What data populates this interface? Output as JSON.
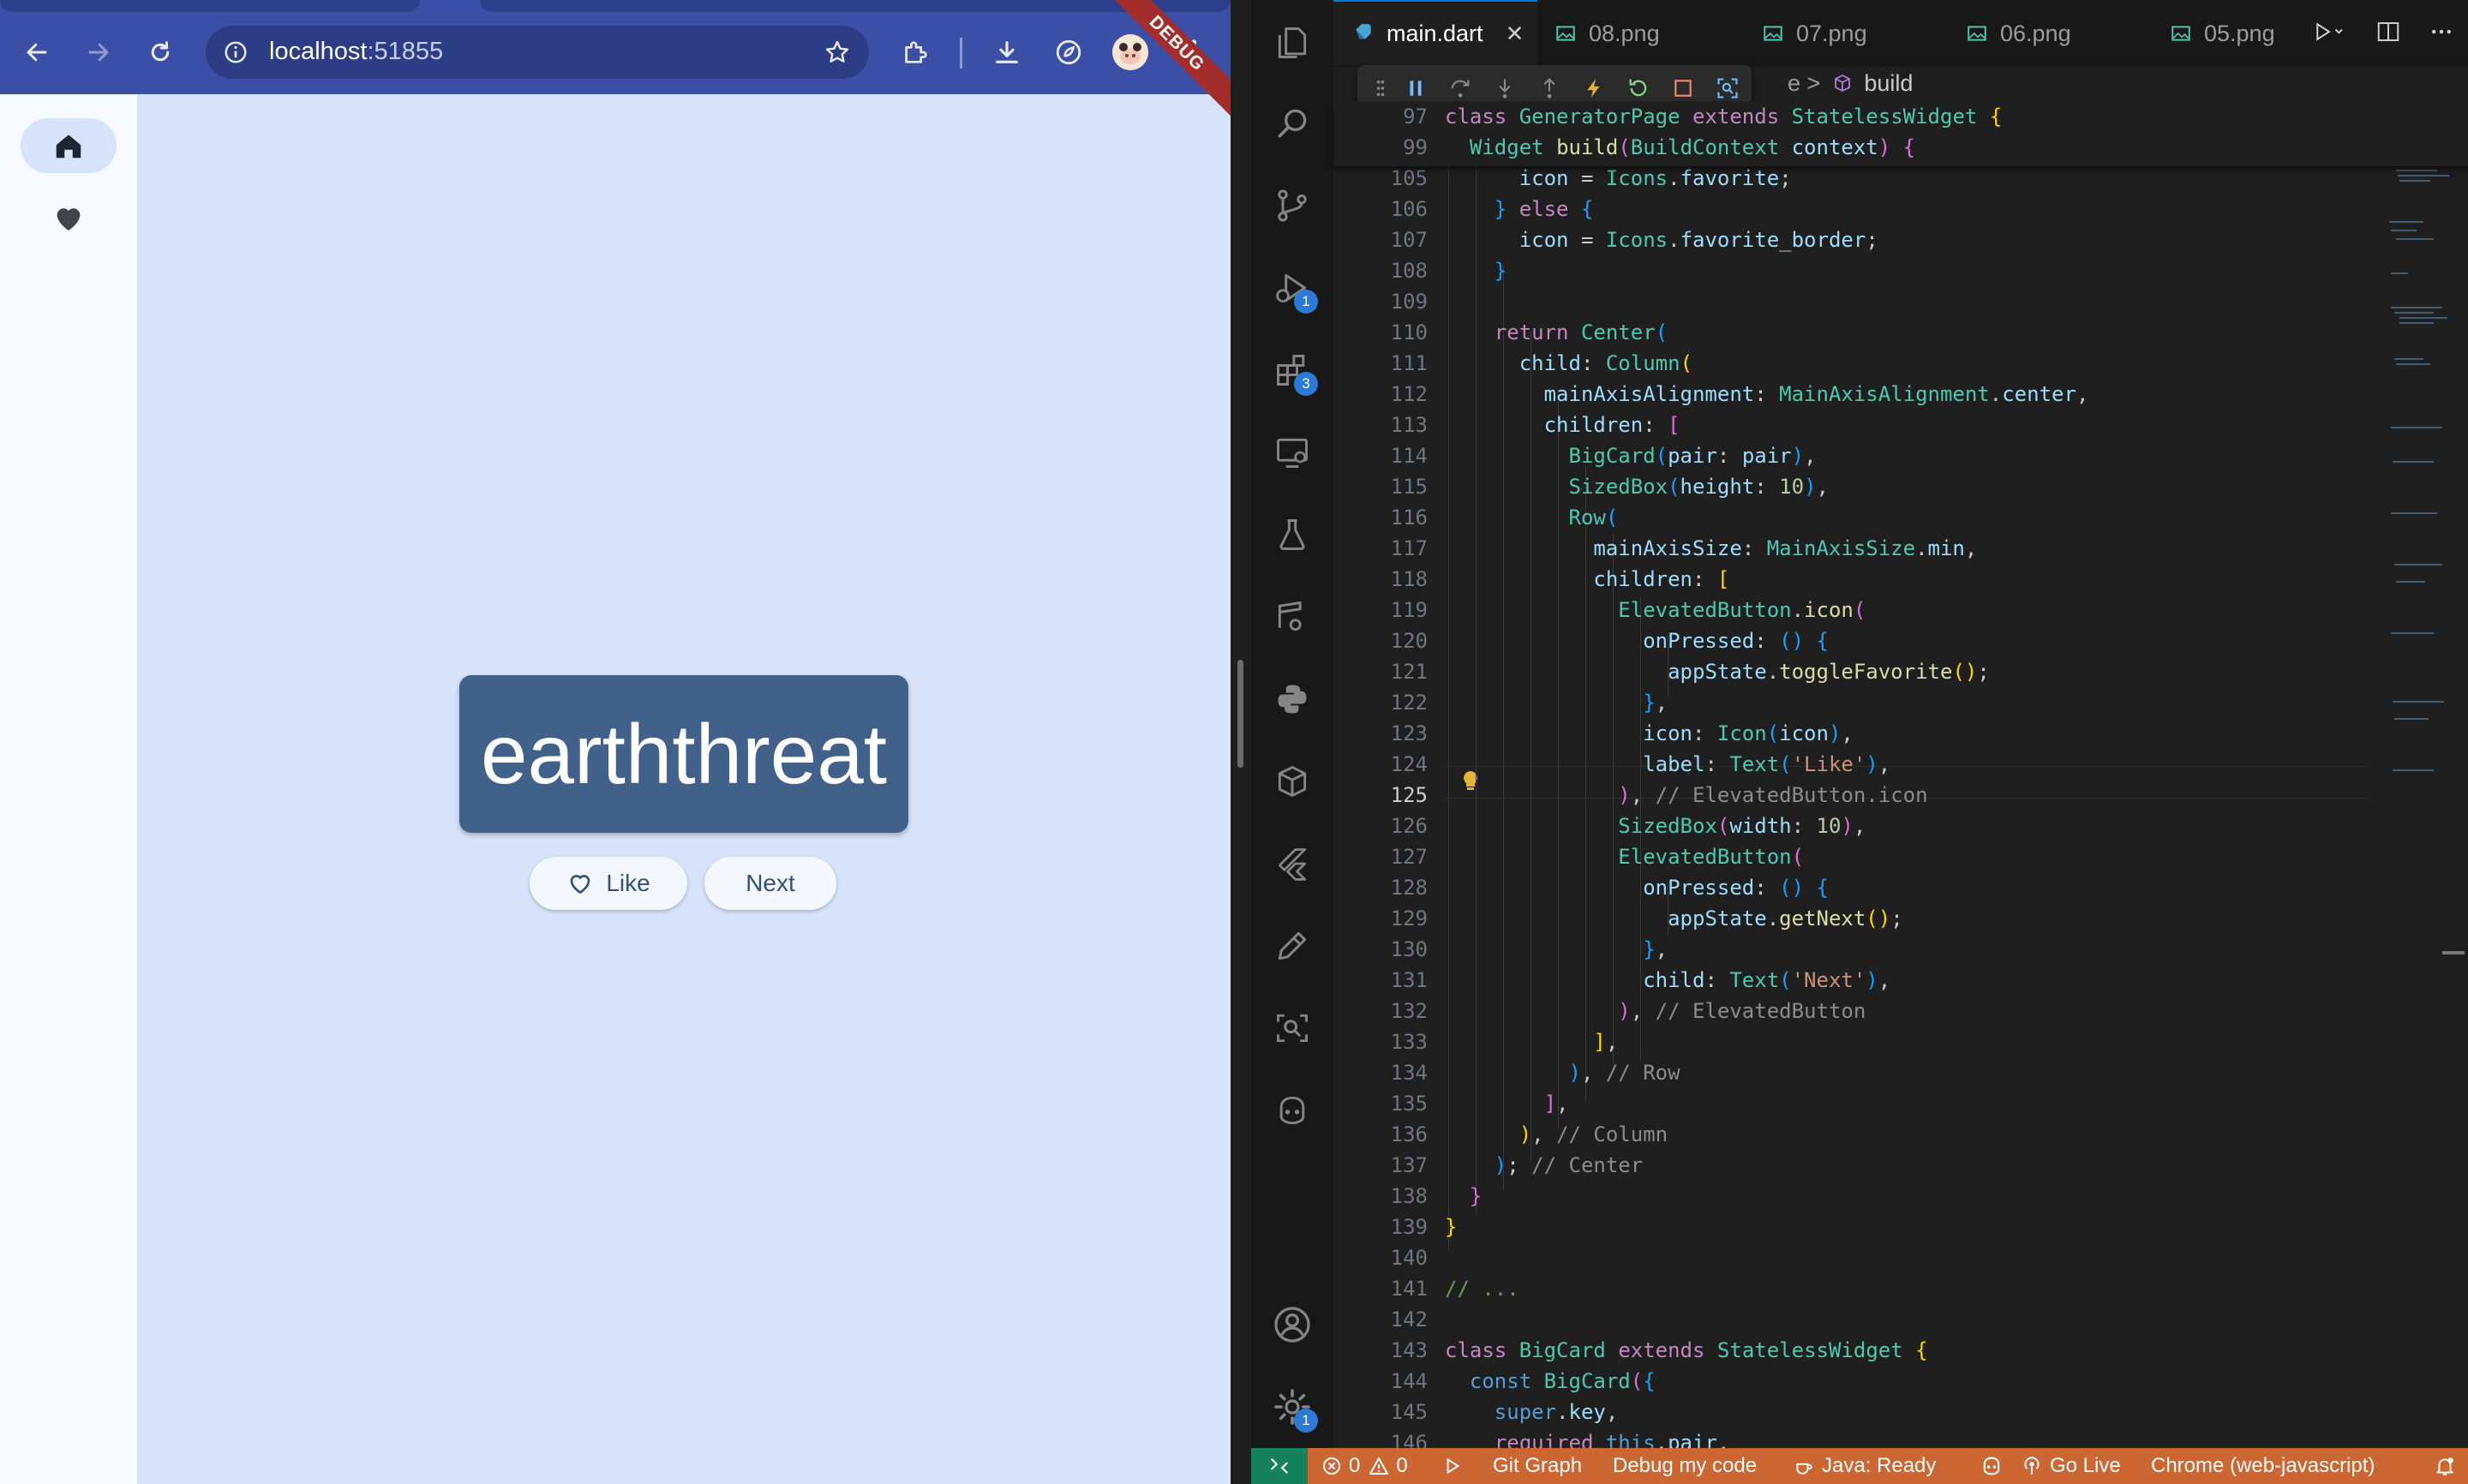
{
  "browser": {
    "url_host": "localhost",
    "url_port": ":51855",
    "debug_banner": "DEBUG"
  },
  "flutter_app": {
    "nav_rail": [
      {
        "label": "Home",
        "icon": "home-icon",
        "selected": true
      },
      {
        "label": "Favorites",
        "icon": "heart-icon",
        "selected": false
      }
    ],
    "card_text": "earththreat",
    "like_label": "Like",
    "next_label": "Next"
  },
  "vscode": {
    "tabs": [
      {
        "label": "main.dart",
        "icon": "dart-icon",
        "active": true
      },
      {
        "label": "08.png",
        "icon": "image-icon",
        "active": false
      },
      {
        "label": "07.png",
        "icon": "image-icon",
        "active": false
      },
      {
        "label": "06.png",
        "icon": "image-icon",
        "active": false
      },
      {
        "label": "05.png",
        "icon": "image-icon",
        "active": false
      }
    ],
    "breadcrumb_tail": "build",
    "breadcrumb_sep": "e >",
    "activity_badges": {
      "run_debug": "1",
      "extensions": "3",
      "settings": "1"
    },
    "sticky_lines": [
      {
        "num": "97",
        "code": "class GeneratorPage extends StatelessWidget {"
      },
      {
        "num": "99",
        "code": "  Widget build(BuildContext context) {"
      }
    ],
    "code_lines": [
      {
        "num": "105",
        "code": "      icon = Icons.favorite;"
      },
      {
        "num": "106",
        "code": "    } else {"
      },
      {
        "num": "107",
        "code": "      icon = Icons.favorite_border;"
      },
      {
        "num": "108",
        "code": "    }"
      },
      {
        "num": "109",
        "code": ""
      },
      {
        "num": "110",
        "code": "    return Center("
      },
      {
        "num": "111",
        "code": "      child: Column("
      },
      {
        "num": "112",
        "code": "        mainAxisAlignment: MainAxisAlignment.center,"
      },
      {
        "num": "113",
        "code": "        children: ["
      },
      {
        "num": "114",
        "code": "          BigCard(pair: pair),"
      },
      {
        "num": "115",
        "code": "          SizedBox(height: 10),"
      },
      {
        "num": "116",
        "code": "          Row("
      },
      {
        "num": "117",
        "code": "            mainAxisSize: MainAxisSize.min,"
      },
      {
        "num": "118",
        "code": "            children: ["
      },
      {
        "num": "119",
        "code": "              ElevatedButton.icon("
      },
      {
        "num": "120",
        "code": "                onPressed: () {"
      },
      {
        "num": "121",
        "code": "                  appState.toggleFavorite();"
      },
      {
        "num": "122",
        "code": "                },"
      },
      {
        "num": "123",
        "code": "                icon: Icon(icon),"
      },
      {
        "num": "124",
        "code": "                label: Text('Like'),"
      },
      {
        "num": "125",
        "code": "              ), // ElevatedButton.icon"
      },
      {
        "num": "126",
        "code": "              SizedBox(width: 10),"
      },
      {
        "num": "127",
        "code": "              ElevatedButton("
      },
      {
        "num": "128",
        "code": "                onPressed: () {"
      },
      {
        "num": "129",
        "code": "                  appState.getNext();"
      },
      {
        "num": "130",
        "code": "                },"
      },
      {
        "num": "131",
        "code": "                child: Text('Next'),"
      },
      {
        "num": "132",
        "code": "              ), // ElevatedButton"
      },
      {
        "num": "133",
        "code": "            ],"
      },
      {
        "num": "134",
        "code": "          ), // Row"
      },
      {
        "num": "135",
        "code": "        ],"
      },
      {
        "num": "136",
        "code": "      ), // Column"
      },
      {
        "num": "137",
        "code": "    ); // Center"
      },
      {
        "num": "138",
        "code": "  }"
      },
      {
        "num": "139",
        "code": "}"
      },
      {
        "num": "140",
        "code": ""
      },
      {
        "num": "141",
        "code": "// ..."
      },
      {
        "num": "142",
        "code": ""
      },
      {
        "num": "143",
        "code": "class BigCard extends StatelessWidget {"
      },
      {
        "num": "144",
        "code": "  const BigCard({"
      },
      {
        "num": "145",
        "code": "    super.key,"
      },
      {
        "num": "146",
        "code": "    required this.pair,"
      }
    ],
    "current_line": "125",
    "status": {
      "errors": "0",
      "warnings": "0",
      "git_graph": "Git Graph",
      "debug_my_code": "Debug my code",
      "java": "Java: Ready",
      "go_live": "Go Live",
      "debug_target": "Chrome (web-javascript)"
    }
  },
  "colors": {
    "chrome_toolbar": "#3a4fa5",
    "flutter_bg": "#d6e3fb",
    "card": "#41618b",
    "status_bar": "#cc6633",
    "vscode_bg": "#1f1f1f"
  }
}
